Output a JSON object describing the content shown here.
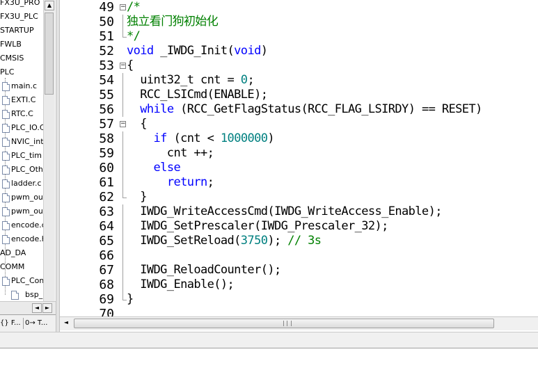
{
  "project_tree": {
    "items": [
      {
        "label": "FX3U_PRO",
        "type": "folder"
      },
      {
        "label": "FX3U_PLC",
        "type": "folder"
      },
      {
        "label": "STARTUP",
        "type": "folder"
      },
      {
        "label": "FWLB",
        "type": "folder"
      },
      {
        "label": "CMSIS",
        "type": "folder"
      },
      {
        "label": "PLC",
        "type": "folder"
      },
      {
        "label": "main.c",
        "type": "file"
      },
      {
        "label": "EXTI.C",
        "type": "file"
      },
      {
        "label": "RTC.C",
        "type": "file"
      },
      {
        "label": "PLC_IO.C",
        "type": "file"
      },
      {
        "label": "NVIC_int",
        "type": "file"
      },
      {
        "label": "PLC_tim",
        "type": "file"
      },
      {
        "label": "PLC_Oth",
        "type": "file"
      },
      {
        "label": "ladder.c",
        "type": "file"
      },
      {
        "label": "pwm_ou",
        "type": "file"
      },
      {
        "label": "pwm_ou",
        "type": "file"
      },
      {
        "label": "encode.c",
        "type": "file"
      },
      {
        "label": "encode.h",
        "type": "file"
      },
      {
        "label": "AD_DA",
        "type": "folder"
      },
      {
        "label": "COMM",
        "type": "folder"
      },
      {
        "label": "PLC_Com",
        "type": "file"
      },
      {
        "label": "bsp_",
        "type": "file"
      }
    ],
    "tabs": [
      {
        "label": "{} F...",
        "icon": "functions-icon"
      },
      {
        "label": "0→ T...",
        "icon": "templates-icon"
      }
    ]
  },
  "editor": {
    "lines": [
      {
        "num": "49",
        "fold": "minus",
        "segs": [
          {
            "t": "/*",
            "c": "cm"
          }
        ]
      },
      {
        "num": "50",
        "fold": "line",
        "segs": [
          {
            "t": "独立看门狗初始化",
            "c": "cm"
          }
        ]
      },
      {
        "num": "51",
        "fold": "end",
        "segs": [
          {
            "t": "*/",
            "c": "cm"
          }
        ]
      },
      {
        "num": "52",
        "fold": "",
        "segs": [
          {
            "t": "void",
            "c": "kw"
          },
          {
            "t": " _IWDG_Init(",
            "c": ""
          },
          {
            "t": "void",
            "c": "kw"
          },
          {
            "t": ")",
            "c": ""
          }
        ]
      },
      {
        "num": "53",
        "fold": "minus",
        "segs": [
          {
            "t": "{",
            "c": ""
          }
        ]
      },
      {
        "num": "54",
        "fold": "line",
        "segs": [
          {
            "t": "  uint32_t cnt = ",
            "c": ""
          },
          {
            "t": "0",
            "c": "num"
          },
          {
            "t": ";",
            "c": ""
          }
        ]
      },
      {
        "num": "55",
        "fold": "line",
        "segs": [
          {
            "t": "  RCC_LSICmd(ENABLE);",
            "c": ""
          }
        ]
      },
      {
        "num": "56",
        "fold": "line",
        "segs": [
          {
            "t": "  ",
            "c": ""
          },
          {
            "t": "while",
            "c": "kw"
          },
          {
            "t": " (RCC_GetFlagStatus(RCC_FLAG_LSIRDY) == RESET)",
            "c": ""
          }
        ]
      },
      {
        "num": "57",
        "fold": "minus",
        "segs": [
          {
            "t": "  {",
            "c": ""
          }
        ]
      },
      {
        "num": "58",
        "fold": "line",
        "segs": [
          {
            "t": "    ",
            "c": ""
          },
          {
            "t": "if",
            "c": "kw"
          },
          {
            "t": " (cnt < ",
            "c": ""
          },
          {
            "t": "1000000",
            "c": "num"
          },
          {
            "t": ")",
            "c": ""
          }
        ]
      },
      {
        "num": "59",
        "fold": "line",
        "segs": [
          {
            "t": "      cnt ++;",
            "c": ""
          }
        ]
      },
      {
        "num": "60",
        "fold": "line",
        "segs": [
          {
            "t": "    ",
            "c": ""
          },
          {
            "t": "else",
            "c": "kw"
          }
        ]
      },
      {
        "num": "61",
        "fold": "line",
        "segs": [
          {
            "t": "      ",
            "c": ""
          },
          {
            "t": "return",
            "c": "kw"
          },
          {
            "t": ";",
            "c": ""
          }
        ]
      },
      {
        "num": "62",
        "fold": "end",
        "segs": [
          {
            "t": "  }",
            "c": ""
          }
        ]
      },
      {
        "num": "63",
        "fold": "line",
        "segs": [
          {
            "t": "  IWDG_WriteAccessCmd(IWDG_WriteAccess_Enable);",
            "c": ""
          }
        ]
      },
      {
        "num": "64",
        "fold": "line",
        "segs": [
          {
            "t": "  IWDG_SetPrescaler(IWDG_Prescaler_32);",
            "c": ""
          }
        ]
      },
      {
        "num": "65",
        "fold": "line",
        "segs": [
          {
            "t": "  IWDG_SetReload(",
            "c": ""
          },
          {
            "t": "3750",
            "c": "num"
          },
          {
            "t": "); ",
            "c": ""
          },
          {
            "t": "// 3s",
            "c": "cm"
          }
        ]
      },
      {
        "num": "66",
        "fold": "line",
        "segs": []
      },
      {
        "num": "67",
        "fold": "line",
        "segs": [
          {
            "t": "  IWDG_ReloadCounter();",
            "c": ""
          }
        ]
      },
      {
        "num": "68",
        "fold": "line",
        "segs": [
          {
            "t": "  IWDG_Enable();",
            "c": ""
          }
        ]
      },
      {
        "num": "69",
        "fold": "end",
        "segs": [
          {
            "t": "}",
            "c": ""
          }
        ]
      },
      {
        "num": "70",
        "fold": "",
        "segs": []
      }
    ]
  },
  "colors": {
    "keyword": "#0000ff",
    "comment": "#008000",
    "number": "#008080"
  },
  "scrollbar": {
    "up_icon": "▲",
    "left_icon": "◄",
    "right_icon": "►",
    "grip_label": ""
  }
}
